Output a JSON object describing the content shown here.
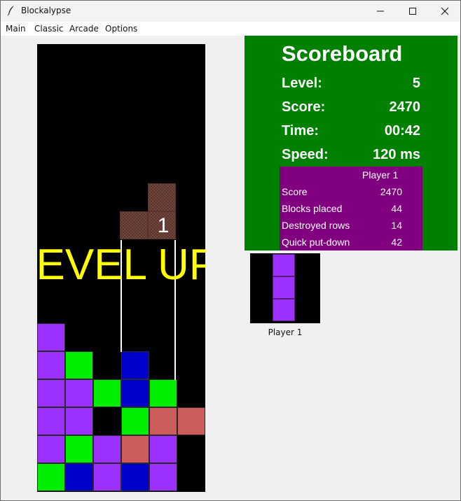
{
  "window": {
    "title": "Blockalypse"
  },
  "menu": {
    "items": [
      "Main",
      "Classic",
      "Arcade",
      "Options"
    ]
  },
  "board": {
    "columns": 6,
    "rows": 16,
    "overlay_text": "LEVEL UP",
    "countdown": "1",
    "colors": {
      "purple": "#9b30ff",
      "green": "#00ee00",
      "blue": "#0000cd",
      "red": "#cd5c5c",
      "brown": "#7a4a40",
      "background": "#000000"
    },
    "cells": [
      {
        "row": 10,
        "col": 0,
        "color": "purple"
      },
      {
        "row": 11,
        "col": 0,
        "color": "purple"
      },
      {
        "row": 11,
        "col": 1,
        "color": "green"
      },
      {
        "row": 11,
        "col": 3,
        "color": "blue"
      },
      {
        "row": 12,
        "col": 0,
        "color": "purple"
      },
      {
        "row": 12,
        "col": 1,
        "color": "purple"
      },
      {
        "row": 12,
        "col": 2,
        "color": "green"
      },
      {
        "row": 12,
        "col": 3,
        "color": "blue"
      },
      {
        "row": 12,
        "col": 4,
        "color": "green"
      },
      {
        "row": 13,
        "col": 0,
        "color": "purple"
      },
      {
        "row": 13,
        "col": 1,
        "color": "purple"
      },
      {
        "row": 13,
        "col": 3,
        "color": "green"
      },
      {
        "row": 13,
        "col": 4,
        "color": "red"
      },
      {
        "row": 13,
        "col": 5,
        "color": "red"
      },
      {
        "row": 14,
        "col": 0,
        "color": "purple"
      },
      {
        "row": 14,
        "col": 1,
        "color": "green"
      },
      {
        "row": 14,
        "col": 2,
        "color": "purple"
      },
      {
        "row": 14,
        "col": 3,
        "color": "red"
      },
      {
        "row": 14,
        "col": 4,
        "color": "purple"
      },
      {
        "row": 15,
        "col": 0,
        "color": "green"
      },
      {
        "row": 15,
        "col": 1,
        "color": "blue"
      },
      {
        "row": 15,
        "col": 2,
        "color": "purple"
      },
      {
        "row": 15,
        "col": 3,
        "color": "blue"
      },
      {
        "row": 15,
        "col": 4,
        "color": "purple"
      }
    ],
    "falling_piece": [
      {
        "row": 5,
        "col": 4
      },
      {
        "row": 6,
        "col": 3
      },
      {
        "row": 6,
        "col": 4
      }
    ]
  },
  "scoreboard": {
    "title": "Scoreboard",
    "level_label": "Level:",
    "level": "5",
    "score_label": "Score:",
    "score": "2470",
    "time_label": "Time:",
    "time": "00:42",
    "speed_label": "Speed:",
    "speed": "120 ms",
    "background": "#008000",
    "player": {
      "name": "Player 1",
      "background": "#800080",
      "stats": [
        {
          "label": "Score",
          "value": "2470"
        },
        {
          "label": "Blocks placed",
          "value": "44"
        },
        {
          "label": "Destroyed rows",
          "value": "14"
        },
        {
          "label": "Quick put-down",
          "value": "42"
        }
      ]
    }
  },
  "preview": {
    "label": "Player 1",
    "color": "#9b30ff",
    "cells": 3
  }
}
